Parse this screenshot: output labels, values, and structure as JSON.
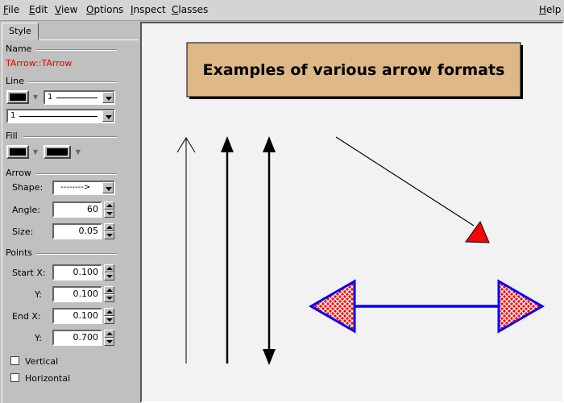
{
  "menubar": {
    "file": {
      "key": "F",
      "rest": "ile"
    },
    "edit": {
      "key": "E",
      "rest": "dit"
    },
    "view": {
      "key": "V",
      "rest": "iew"
    },
    "options": {
      "key": "O",
      "rest": "ptions"
    },
    "inspect": {
      "key": "I",
      "rest": "nspect"
    },
    "classes": {
      "key": "C",
      "rest": "lasses"
    },
    "help": {
      "key": "H",
      "rest": "elp"
    }
  },
  "panel": {
    "tab": "Style",
    "name_group": "Name",
    "object_name": "TArrow::TArrow",
    "line_group": "Line",
    "line_width": "1",
    "line_style": "1",
    "fill_group": "Fill",
    "arrow_group": "Arrow",
    "shape_label": "Shape:",
    "shape_value": "-------->",
    "angle_label": "Angle:",
    "angle_value": "60",
    "size_label": "Size:",
    "size_value": "0.05",
    "points_group": "Points",
    "start_x_label": "Start X:",
    "start_x_value": "0.100",
    "start_y_label": "Y:",
    "start_y_value": "0.100",
    "end_x_label": "End X:",
    "end_x_value": "0.100",
    "end_y_label": "Y:",
    "end_y_value": "0.700",
    "vertical_label": "Vertical",
    "horizontal_label": "Horizontal",
    "vertical_checked": false,
    "horizontal_checked": false
  },
  "canvas": {
    "title": "Examples of various arrow formats",
    "colors": {
      "title_fill": "#deb887",
      "canvas_bg": "#f2f2f2",
      "arrow_red": "#ff0000",
      "arrow_blue": "#0000ff"
    }
  }
}
